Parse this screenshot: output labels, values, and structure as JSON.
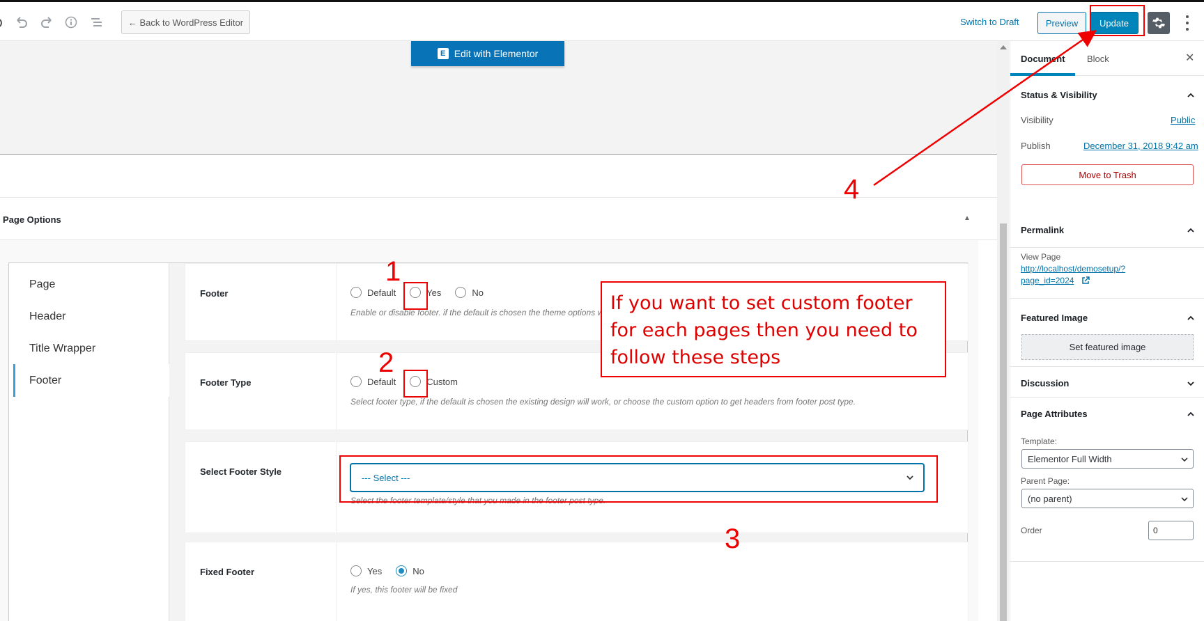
{
  "topbar": {
    "back_label": "← Back to WordPress Editor",
    "switch_draft_label": "Switch to Draft",
    "preview_label": "Preview",
    "update_label": "Update"
  },
  "editor": {
    "edit_elementor_label": "Edit with Elementor",
    "elementor_logo_letter": "E",
    "page_options_title": "Page Options",
    "tabs": [
      "Page",
      "Header",
      "Title Wrapper",
      "Footer"
    ],
    "active_tab": "Footer",
    "fields": {
      "footer": {
        "label": "Footer",
        "options": [
          "Default",
          "Yes",
          "No"
        ],
        "desc": "Enable or disable footer. if the default is chosen the theme options will work."
      },
      "footer_type": {
        "label": "Footer Type",
        "options": [
          "Default",
          "Custom"
        ],
        "desc": "Select footer type, if the default is chosen the existing design will work, or choose the custom option to get headers from footer post type."
      },
      "footer_style": {
        "label": "Select Footer Style",
        "selected": "--- Select ---",
        "desc": "Select the footer template/style that you made in the footer post type."
      },
      "fixed_footer": {
        "label": "Fixed Footer",
        "options": [
          "Yes",
          "No"
        ],
        "selected": "No",
        "desc": "If yes, this footer will be fixed"
      }
    }
  },
  "sidebar": {
    "tab_document": "Document",
    "tab_block": "Block",
    "close": "✕",
    "status": {
      "title": "Status & Visibility",
      "visibility_label": "Visibility",
      "visibility_value": "Public",
      "publish_label": "Publish",
      "publish_value": "December 31, 2018 9:42 am",
      "trash_label": "Move to Trash"
    },
    "permalink": {
      "title": "Permalink",
      "view_label": "View Page",
      "url_line1": "http://localhost/demosetup/?",
      "url_line2": "page_id=2024"
    },
    "featured": {
      "title": "Featured Image",
      "button": "Set featured image"
    },
    "discussion": {
      "title": "Discussion"
    },
    "attributes": {
      "title": "Page Attributes",
      "template_label": "Template:",
      "template_value": "Elementor Full Width",
      "parent_label": "Parent Page:",
      "parent_value": "(no parent)",
      "order_label": "Order",
      "order_value": "0"
    }
  },
  "annotations": {
    "callout_text": "If you want to set custom footer for each pages then  you need to follow these steps",
    "step1": "1",
    "step2": "2",
    "step3": "3",
    "step4": "4",
    "color": "#e00000"
  },
  "colors": {
    "primary": "#0085ba",
    "link": "#0073aa",
    "active_tab_bar": "#37a0dc"
  }
}
